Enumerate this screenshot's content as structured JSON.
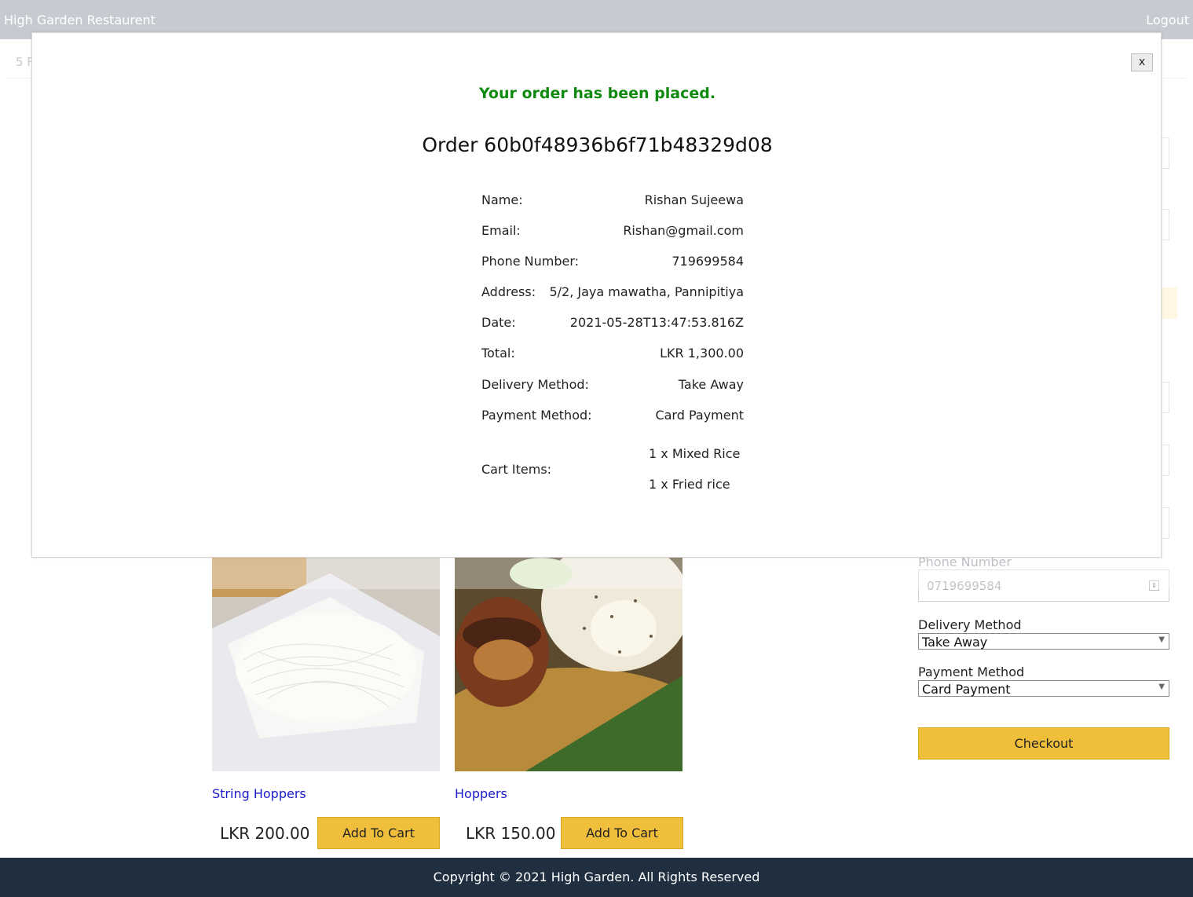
{
  "navbar": {
    "brand": "High Garden Restaurent",
    "logout": "Logout"
  },
  "subbar": {
    "text": "5 F"
  },
  "checkout_form": {
    "phone_label": "Phone Number",
    "phone_value": "0719699584",
    "delivery_label": "Delivery Method",
    "delivery_value": "Take Away",
    "payment_label": "Payment Method",
    "payment_value": "Card Payment",
    "checkout_label": "Checkout"
  },
  "products": [
    {
      "name": "String Hoppers",
      "price": "LKR 200.00",
      "add_label": "Add To Cart"
    },
    {
      "name": "Hoppers",
      "price": "LKR 150.00",
      "add_label": "Add To Cart"
    }
  ],
  "footer": {
    "text": "Copyright © 2021 High Garden. All Rights Reserved"
  },
  "modal": {
    "close_label": "x",
    "success_message": "Your order has been placed.",
    "order_title": "Order 60b0f48936b6f71b48329d08",
    "rows": [
      {
        "label": "Name:",
        "value": "Rishan Sujeewa"
      },
      {
        "label": "Email:",
        "value": "Rishan@gmail.com"
      },
      {
        "label": "Phone Number:",
        "value": "719699584"
      },
      {
        "label": "Address:",
        "value": "5/2, Jaya mawatha, Pannipitiya"
      },
      {
        "label": "Date:",
        "value": "2021-05-28T13:47:53.816Z"
      },
      {
        "label": "Total:",
        "value": "LKR 1,300.00"
      },
      {
        "label": "Delivery Method:",
        "value": "Take Away"
      },
      {
        "label": "Payment Method:",
        "value": "Card Payment"
      }
    ],
    "cart_label": "Cart Items:",
    "cart_items": [
      "1 x Mixed Rice",
      "1 x Fried rice"
    ]
  },
  "colors": {
    "navbar_bg": "#c7cbd1",
    "footer_bg": "#1f2f40",
    "accent_button": "#efbf3b",
    "success_text": "#0f8a0f",
    "product_link": "#1a1acc"
  }
}
